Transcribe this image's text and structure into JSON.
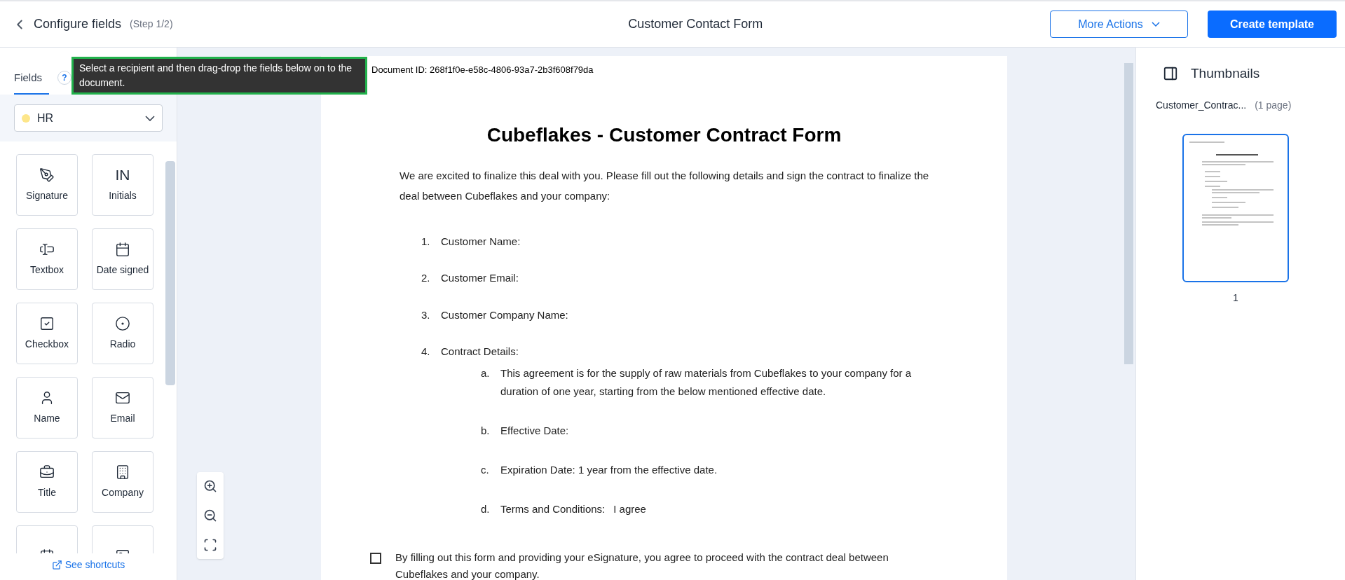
{
  "header": {
    "title": "Configure fields",
    "step": "(Step 1/2)",
    "document_title": "Customer Contact Form",
    "more_actions": "More Actions",
    "create": "Create template"
  },
  "sidebar": {
    "tabs": [
      {
        "label": "Fields",
        "selected": true
      }
    ],
    "help": "?",
    "tooltip": "Select a recipient and then drag-drop the fields below on to the document.",
    "recipient": {
      "name": "HR",
      "color": "#fde68a"
    },
    "fields": [
      {
        "kind": "signature",
        "label": "Signature"
      },
      {
        "kind": "initials",
        "label": "Initials"
      },
      {
        "kind": "textbox",
        "label": "Textbox"
      },
      {
        "kind": "date",
        "label": "Date signed"
      },
      {
        "kind": "checkbox",
        "label": "Checkbox"
      },
      {
        "kind": "radio",
        "label": "Radio"
      },
      {
        "kind": "name",
        "label": "Name"
      },
      {
        "kind": "email",
        "label": "Email"
      },
      {
        "kind": "title",
        "label": "Title"
      },
      {
        "kind": "company",
        "label": "Company"
      },
      {
        "kind": "dateedit"
      },
      {
        "kind": "image"
      }
    ],
    "shortcuts": "See shortcuts",
    "initials_glyph": "IN"
  },
  "document": {
    "id_line": "Document ID: 268f1f0e-e58c-4806-93a7-2b3f608f79da",
    "heading": "Cubeflakes  - Customer Contract Form",
    "intro": "We are excited to finalize this deal with you. Please fill out the following details and sign the contract to finalize the deal between Cubeflakes and your company:",
    "items": [
      {
        "marker": "1.",
        "text": "Customer Name:"
      },
      {
        "marker": "2.",
        "text": "Customer Email:"
      },
      {
        "marker": "3.",
        "text": "Customer Company Name:"
      },
      {
        "marker": "4.",
        "text": "Contract Details:",
        "children": [
          {
            "marker": "a.",
            "text": "This agreement is for the supply of raw materials from Cubeflakes to your company for a duration of one year, starting from the below mentioned effective date."
          },
          {
            "marker": "b.",
            "text": "Effective Date:"
          },
          {
            "marker": "c.",
            "text": "Expiration Date: 1 year from the effective date."
          },
          {
            "marker": "d.",
            "text": "Terms and Conditions:",
            "value": "I agree"
          }
        ]
      }
    ],
    "consents": [
      {
        "text": "By filling out this form and providing your eSignature, you agree to proceed with the contract deal between Cubeflakes and your company.",
        "checked": false
      }
    ]
  },
  "thumbnails": {
    "title": "Thumbnails",
    "file": "Customer_Contrac...",
    "pages": "(1 page)",
    "items": [
      {
        "number": "1",
        "selected": true
      }
    ]
  }
}
